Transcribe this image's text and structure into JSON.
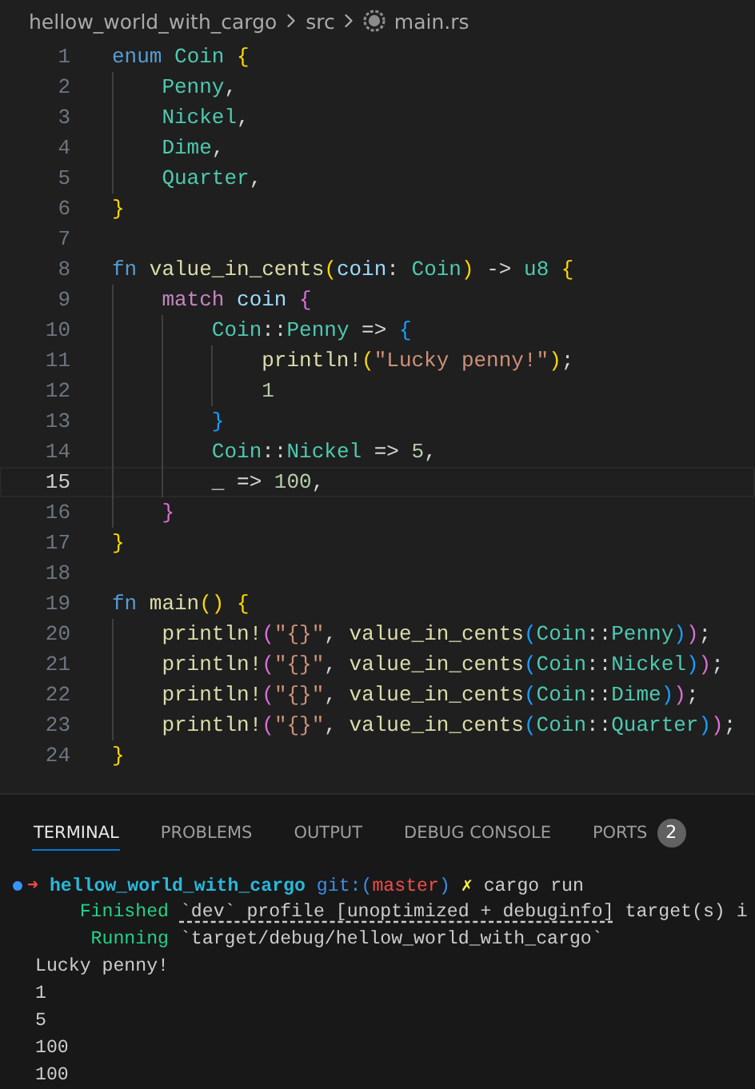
{
  "breadcrumb": {
    "items": [
      "hellow_world_with_cargo",
      "src",
      "main.rs"
    ]
  },
  "editor": {
    "lines": [
      {
        "number": "1",
        "current": false,
        "tokens": [
          {
            "kind": "kw",
            "text": "enum "
          },
          {
            "kind": "type",
            "text": "Coin "
          },
          {
            "kind": "b1",
            "text": "{"
          }
        ]
      },
      {
        "number": "2",
        "current": false,
        "tokens": [
          {
            "kind": "type",
            "text": "    Penny"
          },
          {
            "kind": "p",
            "text": ","
          }
        ]
      },
      {
        "number": "3",
        "current": false,
        "tokens": [
          {
            "kind": "type",
            "text": "    Nickel"
          },
          {
            "kind": "p",
            "text": ","
          }
        ]
      },
      {
        "number": "4",
        "current": false,
        "tokens": [
          {
            "kind": "type",
            "text": "    Dime"
          },
          {
            "kind": "p",
            "text": ","
          }
        ]
      },
      {
        "number": "5",
        "current": false,
        "tokens": [
          {
            "kind": "type",
            "text": "    Quarter"
          },
          {
            "kind": "p",
            "text": ","
          }
        ]
      },
      {
        "number": "6",
        "current": false,
        "tokens": [
          {
            "kind": "b1",
            "text": "}"
          }
        ]
      },
      {
        "number": "7",
        "current": false
      },
      {
        "number": "8",
        "current": false,
        "tokens": [
          {
            "kind": "kw",
            "text": "fn "
          },
          {
            "kind": "fn",
            "text": "value_in_cents"
          },
          {
            "kind": "b1",
            "text": "("
          },
          {
            "kind": "var",
            "text": "coin"
          },
          {
            "kind": "p",
            "text": ": "
          },
          {
            "kind": "type",
            "text": "Coin"
          },
          {
            "kind": "b1",
            "text": ")"
          },
          {
            "kind": "p",
            "text": " -> "
          },
          {
            "kind": "type",
            "text": "u8 "
          },
          {
            "kind": "b1",
            "text": "{"
          }
        ]
      },
      {
        "number": "9",
        "current": false,
        "tokens": [
          {
            "kind": "ctl",
            "text": "    match "
          },
          {
            "kind": "var",
            "text": "coin "
          },
          {
            "kind": "b2",
            "text": "{"
          }
        ]
      },
      {
        "number": "10",
        "current": false,
        "tokens": [
          {
            "kind": "type",
            "text": "        Coin"
          },
          {
            "kind": "p",
            "text": "::"
          },
          {
            "kind": "type",
            "text": "Penny "
          },
          {
            "kind": "p",
            "text": "=> "
          },
          {
            "kind": "b3",
            "text": "{"
          }
        ]
      },
      {
        "number": "11",
        "current": false,
        "tokens": [
          {
            "kind": "fn",
            "text": "            println!"
          },
          {
            "kind": "b1",
            "text": "("
          },
          {
            "kind": "str",
            "text": "\"Lucky penny!\""
          },
          {
            "kind": "b1",
            "text": ")"
          },
          {
            "kind": "p",
            "text": ";"
          }
        ]
      },
      {
        "number": "12",
        "current": false,
        "tokens": [
          {
            "kind": "num",
            "text": "            1"
          }
        ]
      },
      {
        "number": "13",
        "current": false,
        "tokens": [
          {
            "kind": "b3",
            "text": "        }"
          }
        ]
      },
      {
        "number": "14",
        "current": false,
        "tokens": [
          {
            "kind": "type",
            "text": "        Coin"
          },
          {
            "kind": "p",
            "text": "::"
          },
          {
            "kind": "type",
            "text": "Nickel "
          },
          {
            "kind": "p",
            "text": "=> "
          },
          {
            "kind": "num",
            "text": "5"
          },
          {
            "kind": "p",
            "text": ","
          }
        ]
      },
      {
        "number": "15",
        "current": true,
        "tokens": [
          {
            "kind": "p",
            "text": "        _ => "
          },
          {
            "kind": "num",
            "text": "100"
          },
          {
            "kind": "p",
            "text": ","
          }
        ]
      },
      {
        "number": "16",
        "current": false,
        "tokens": [
          {
            "kind": "b2",
            "text": "    }"
          }
        ]
      },
      {
        "number": "17",
        "current": false,
        "tokens": [
          {
            "kind": "b1",
            "text": "}"
          }
        ]
      },
      {
        "number": "18",
        "current": false
      },
      {
        "number": "19",
        "current": false,
        "tokens": [
          {
            "kind": "kw",
            "text": "fn "
          },
          {
            "kind": "fn",
            "text": "main"
          },
          {
            "kind": "b1",
            "text": "() {"
          }
        ]
      },
      {
        "number": "20",
        "current": false,
        "tokens": [
          {
            "kind": "fn",
            "text": "    println!"
          },
          {
            "kind": "b2",
            "text": "("
          },
          {
            "kind": "str",
            "text": "\"{}\""
          },
          {
            "kind": "p",
            "text": ", "
          },
          {
            "kind": "fn",
            "text": "value_in_cents"
          },
          {
            "kind": "b3",
            "text": "("
          },
          {
            "kind": "type",
            "text": "Coin"
          },
          {
            "kind": "p",
            "text": "::"
          },
          {
            "kind": "type",
            "text": "Penny"
          },
          {
            "kind": "b3",
            "text": ")"
          },
          {
            "kind": "b2",
            "text": ")"
          },
          {
            "kind": "p",
            "text": ";"
          }
        ]
      },
      {
        "number": "21",
        "current": false,
        "tokens": [
          {
            "kind": "fn",
            "text": "    println!"
          },
          {
            "kind": "b2",
            "text": "("
          },
          {
            "kind": "str",
            "text": "\"{}\""
          },
          {
            "kind": "p",
            "text": ", "
          },
          {
            "kind": "fn",
            "text": "value_in_cents"
          },
          {
            "kind": "b3",
            "text": "("
          },
          {
            "kind": "type",
            "text": "Coin"
          },
          {
            "kind": "p",
            "text": "::"
          },
          {
            "kind": "type",
            "text": "Nickel"
          },
          {
            "kind": "b3",
            "text": ")"
          },
          {
            "kind": "b2",
            "text": ")"
          },
          {
            "kind": "p",
            "text": ";"
          }
        ]
      },
      {
        "number": "22",
        "current": false,
        "tokens": [
          {
            "kind": "fn",
            "text": "    println!"
          },
          {
            "kind": "b2",
            "text": "("
          },
          {
            "kind": "str",
            "text": "\"{}\""
          },
          {
            "kind": "p",
            "text": ", "
          },
          {
            "kind": "fn",
            "text": "value_in_cents"
          },
          {
            "kind": "b3",
            "text": "("
          },
          {
            "kind": "type",
            "text": "Coin"
          },
          {
            "kind": "p",
            "text": "::"
          },
          {
            "kind": "type",
            "text": "Dime"
          },
          {
            "kind": "b3",
            "text": ")"
          },
          {
            "kind": "b2",
            "text": ")"
          },
          {
            "kind": "p",
            "text": ";"
          }
        ]
      },
      {
        "number": "23",
        "current": false,
        "tokens": [
          {
            "kind": "fn",
            "text": "    println!"
          },
          {
            "kind": "b2",
            "text": "("
          },
          {
            "kind": "str",
            "text": "\"{}\""
          },
          {
            "kind": "p",
            "text": ", "
          },
          {
            "kind": "fn",
            "text": "value_in_cents"
          },
          {
            "kind": "b3",
            "text": "("
          },
          {
            "kind": "type",
            "text": "Coin"
          },
          {
            "kind": "p",
            "text": "::"
          },
          {
            "kind": "type",
            "text": "Quarter"
          },
          {
            "kind": "b3",
            "text": ")"
          },
          {
            "kind": "b2",
            "text": ")"
          },
          {
            "kind": "p",
            "text": ";"
          }
        ]
      },
      {
        "number": "24",
        "current": false,
        "tokens": [
          {
            "kind": "b1",
            "text": "}"
          }
        ]
      }
    ]
  },
  "panel": {
    "tabs": [
      {
        "label": "TERMINAL",
        "selected": true
      },
      {
        "label": "PROBLEMS",
        "selected": false
      },
      {
        "label": "OUTPUT",
        "selected": false
      },
      {
        "label": "DEBUG CONSOLE",
        "selected": false
      },
      {
        "label": "PORTS",
        "selected": false,
        "badge": "2"
      }
    ]
  },
  "terminal": {
    "lines": [
      {
        "kind": "prompt",
        "segments": [
          {
            "kind": "arrow",
            "text": "➜ "
          },
          {
            "kind": "dir",
            "text": "hellow_world_with_cargo "
          },
          {
            "kind": "git",
            "text": "git:("
          },
          {
            "kind": "branch",
            "text": "master"
          },
          {
            "kind": "git",
            "text": ") "
          },
          {
            "kind": "dirty",
            "text": "✗ "
          },
          {
            "kind": "plain",
            "text": "cargo run"
          }
        ]
      },
      {
        "kind": "output",
        "segments": [
          {
            "kind": "green",
            "text": "    Finished "
          },
          {
            "kind": "link",
            "text": "`dev` profile [unoptimized + debuginfo]"
          },
          {
            "kind": "plain",
            "text": " target(s) i"
          }
        ]
      },
      {
        "kind": "output",
        "segments": [
          {
            "kind": "green",
            "text": "     Running "
          },
          {
            "kind": "plain",
            "text": "`target/debug/hellow_world_with_cargo`"
          }
        ]
      },
      {
        "kind": "output",
        "segments": [
          {
            "kind": "plain",
            "text": "Lucky penny!"
          }
        ]
      },
      {
        "kind": "output",
        "segments": [
          {
            "kind": "plain",
            "text": "1"
          }
        ]
      },
      {
        "kind": "output",
        "segments": [
          {
            "kind": "plain",
            "text": "5"
          }
        ]
      },
      {
        "kind": "output",
        "segments": [
          {
            "kind": "plain",
            "text": "100"
          }
        ]
      },
      {
        "kind": "output",
        "segments": [
          {
            "kind": "plain",
            "text": "100"
          }
        ]
      }
    ]
  }
}
